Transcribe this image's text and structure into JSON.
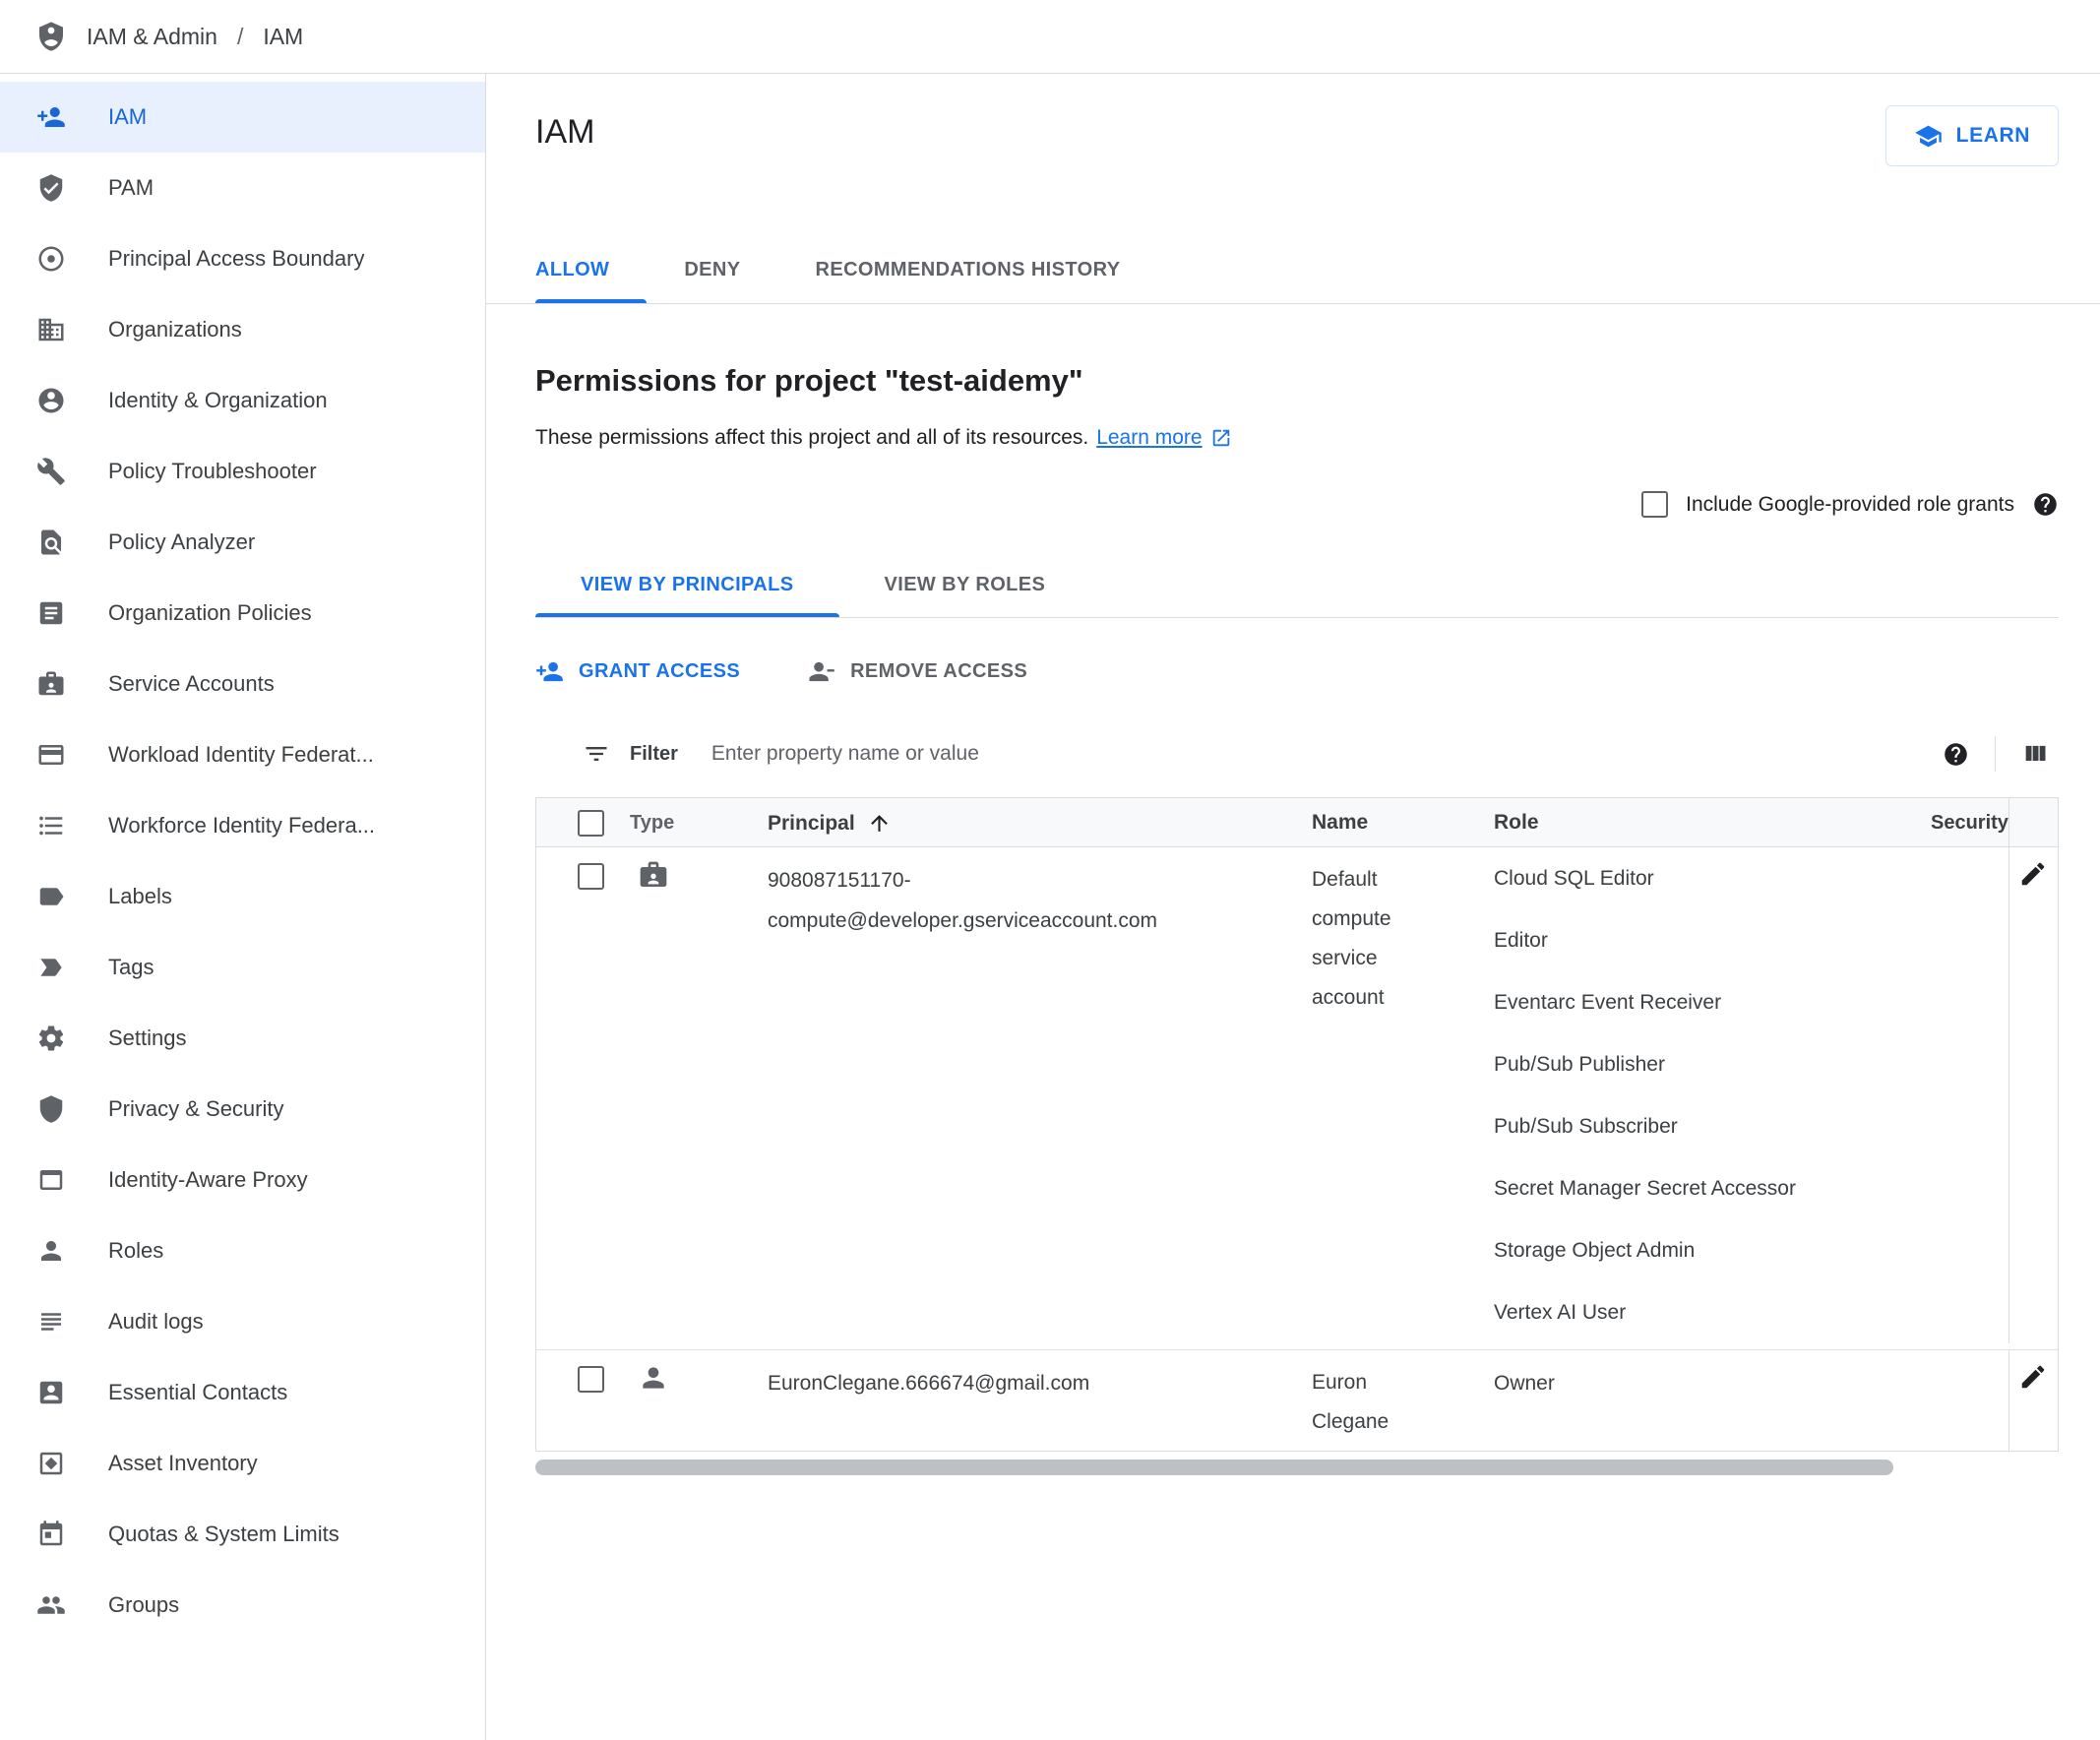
{
  "colors": {
    "accent": "#1a73e8",
    "active_item_bg": "#e8f0fe",
    "active_item_text": "#1967d2",
    "border": "#dadce0"
  },
  "header": {
    "product": "IAM & Admin",
    "separator": "/",
    "page": "IAM"
  },
  "sidebar": {
    "items": [
      {
        "label": "IAM",
        "icon": "person-add-icon",
        "active": true
      },
      {
        "label": "PAM",
        "icon": "shield-check-icon",
        "active": false
      },
      {
        "label": "Principal Access Boundary",
        "icon": "boundary-icon",
        "active": false
      },
      {
        "label": "Organizations",
        "icon": "organization-icon",
        "active": false
      },
      {
        "label": "Identity & Organization",
        "icon": "identity-icon",
        "active": false
      },
      {
        "label": "Policy Troubleshooter",
        "icon": "wrench-icon",
        "active": false
      },
      {
        "label": "Policy Analyzer",
        "icon": "find-in-page-icon",
        "active": false
      },
      {
        "label": "Organization Policies",
        "icon": "article-icon",
        "active": false
      },
      {
        "label": "Service Accounts",
        "icon": "service-account-icon",
        "active": false
      },
      {
        "label": "Workload Identity Federat...",
        "icon": "card-icon",
        "active": false
      },
      {
        "label": "Workforce Identity Federa...",
        "icon": "list-bulleted-icon",
        "active": false
      },
      {
        "label": "Labels",
        "icon": "label-icon",
        "active": false
      },
      {
        "label": "Tags",
        "icon": "tag-icon",
        "active": false
      },
      {
        "label": "Settings",
        "icon": "gear-icon",
        "active": false
      },
      {
        "label": "Privacy & Security",
        "icon": "shield-icon",
        "active": false
      },
      {
        "label": "Identity-Aware Proxy",
        "icon": "window-icon",
        "active": false
      },
      {
        "label": "Roles",
        "icon": "person-icon",
        "active": false
      },
      {
        "label": "Audit logs",
        "icon": "list-lines-icon",
        "active": false
      },
      {
        "label": "Essential Contacts",
        "icon": "contact-card-icon",
        "active": false
      },
      {
        "label": "Asset Inventory",
        "icon": "asset-icon",
        "active": false
      },
      {
        "label": "Quotas & System Limits",
        "icon": "calendar-icon",
        "active": false
      },
      {
        "label": "Groups",
        "icon": "groups-icon",
        "active": false
      }
    ]
  },
  "main": {
    "title": "IAM",
    "learn_button": "LEARN",
    "tabs": [
      {
        "label": "ALLOW",
        "active": true
      },
      {
        "label": "DENY",
        "active": false
      },
      {
        "label": "RECOMMENDATIONS HISTORY",
        "active": false
      }
    ],
    "permissions": {
      "heading": "Permissions for project \"test-aidemy\"",
      "description": "These permissions affect this project and all of its resources.",
      "learn_more": "Learn more",
      "include_label": "Include Google-provided role grants"
    },
    "view_tabs": [
      {
        "label": "VIEW BY PRINCIPALS",
        "active": true
      },
      {
        "label": "VIEW BY ROLES",
        "active": false
      }
    ],
    "actions": {
      "grant": "GRANT ACCESS",
      "remove": "REMOVE ACCESS"
    },
    "filter": {
      "label": "Filter",
      "placeholder": "Enter property name or value"
    },
    "table": {
      "columns": {
        "type": "Type",
        "principal": "Principal",
        "name": "Name",
        "role": "Role",
        "security": "Security"
      },
      "rows": [
        {
          "type": "service-account",
          "principal": "908087151170-compute@developer.gserviceaccount.com",
          "name": "Default compute service account",
          "roles": [
            "Cloud SQL Editor",
            "Editor",
            "Eventarc Event Receiver",
            "Pub/Sub Publisher",
            "Pub/Sub Subscriber",
            "Secret Manager Secret Accessor",
            "Storage Object Admin",
            "Vertex AI User"
          ]
        },
        {
          "type": "user",
          "principal": "EuronClegane.666674@gmail.com",
          "name": "Euron Clegane",
          "roles": [
            "Owner"
          ]
        }
      ]
    }
  }
}
